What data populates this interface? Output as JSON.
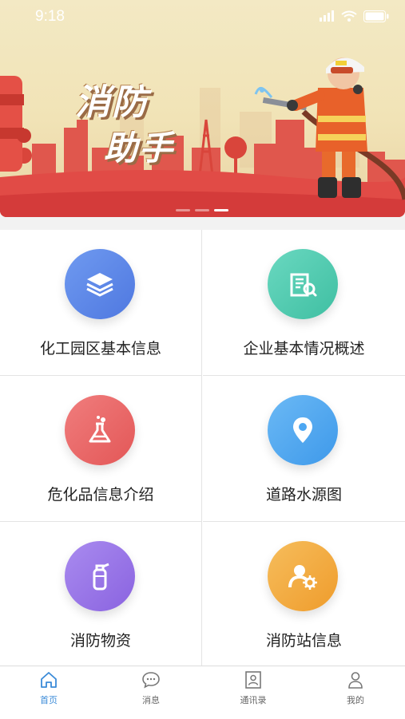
{
  "status_bar": {
    "time": "9:18"
  },
  "banner": {
    "title_line1": "消防",
    "title_line2": "助手",
    "dots": 3,
    "active_dot": 2
  },
  "menu": {
    "items": [
      {
        "label": "化工园区基本信息",
        "icon": "layers-icon",
        "color": "#5b87e8"
      },
      {
        "label": "企业基本情况概述",
        "icon": "building-search-icon",
        "color": "#4ec9b0"
      },
      {
        "label": "危化品信息介绍",
        "icon": "flask-icon",
        "color": "#ee6a6a"
      },
      {
        "label": "道路水源图",
        "icon": "location-pin-icon",
        "color": "#4da7f2"
      },
      {
        "label": "消防物资",
        "icon": "fire-extinguisher-icon",
        "color": "#9b75e8"
      },
      {
        "label": "消防站信息",
        "icon": "user-gear-icon",
        "color": "#f3a53e"
      }
    ]
  },
  "tabbar": {
    "tabs": [
      {
        "label": "首页",
        "icon": "home-icon",
        "active": true
      },
      {
        "label": "消息",
        "icon": "chat-bubble-icon",
        "active": false
      },
      {
        "label": "通讯录",
        "icon": "contacts-icon",
        "active": false
      },
      {
        "label": "我的",
        "icon": "person-icon",
        "active": false
      }
    ],
    "active_color": "#3b8bd8",
    "inactive_color": "#666666"
  }
}
